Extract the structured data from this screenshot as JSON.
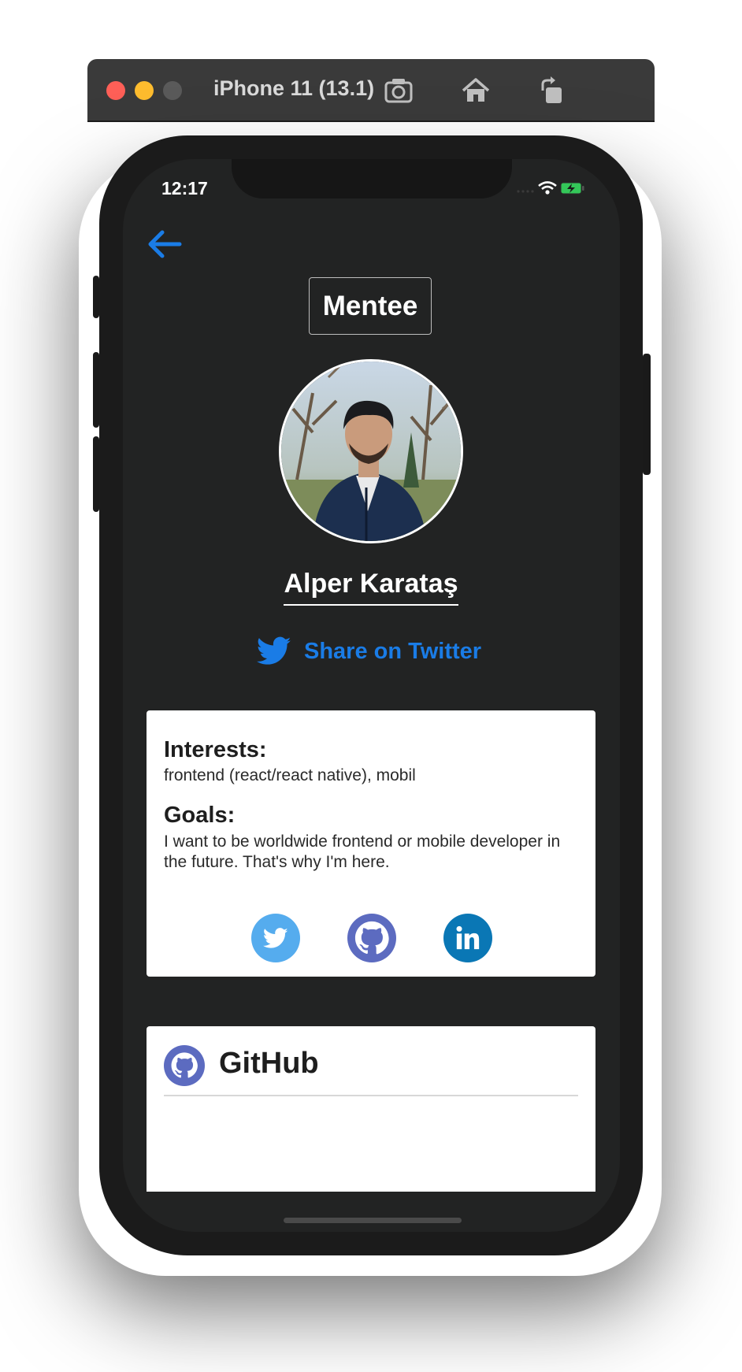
{
  "simulator": {
    "title": "iPhone 11 (13.1)",
    "icons": [
      "screenshot-icon",
      "home-icon",
      "rotate-icon"
    ]
  },
  "status_bar": {
    "time": "12:17"
  },
  "nav": {
    "back_icon": "arrow-left-icon"
  },
  "profile": {
    "role_badge": "Mentee",
    "name": "Alper Karataş",
    "share_label": "Share on Twitter"
  },
  "about": {
    "interests_heading": "Interests:",
    "interests_text": "frontend (react/react native), mobil",
    "goals_heading": "Goals:",
    "goals_text": "I want to be worldwide frontend or mobile developer in the future. That's why I'm here.",
    "social_icons": [
      "twitter-icon",
      "github-icon",
      "linkedin-icon"
    ]
  },
  "github_card": {
    "title": "GitHub"
  },
  "colors": {
    "accent": "#1a7ce6",
    "background": "#222323",
    "twitter": "#55acee",
    "github": "#5c6bc0",
    "linkedin": "#0a77b5"
  }
}
